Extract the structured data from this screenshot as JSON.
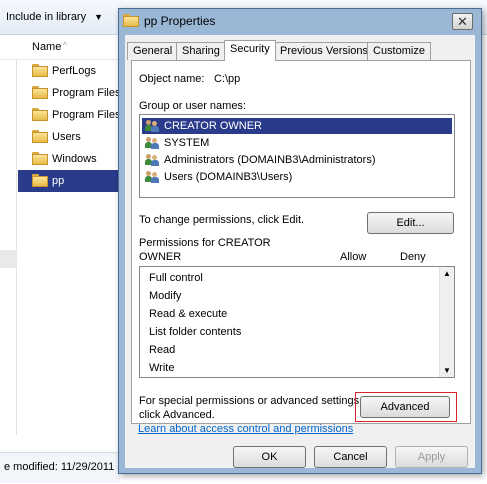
{
  "explorer": {
    "toolbar": {
      "include_label": "Include in library",
      "arrow": "▼"
    },
    "column_name": "Name",
    "sort_glyph": "^",
    "files": [
      {
        "name": "PerfLogs",
        "selected": false
      },
      {
        "name": "Program Files",
        "selected": false
      },
      {
        "name": "Program Files",
        "selected": false
      },
      {
        "name": "Users",
        "selected": false
      },
      {
        "name": "Windows",
        "selected": false
      },
      {
        "name": "pp",
        "selected": true
      }
    ],
    "status": "e modified:  11/29/2011"
  },
  "dialog": {
    "title": "pp Properties",
    "close_glyph": "✕",
    "tabs": [
      "General",
      "Sharing",
      "Security",
      "Previous Versions",
      "Customize"
    ],
    "active_tab": "Security",
    "object_name_label": "Object name:",
    "object_name_value": "C:\\pp",
    "group_label": "Group or user names:",
    "users": [
      {
        "name": "CREATOR OWNER",
        "selected": true
      },
      {
        "name": "SYSTEM",
        "selected": false
      },
      {
        "name": "Administrators (DOMAINB3\\Administrators)",
        "selected": false
      },
      {
        "name": "Users (DOMAINB3\\Users)",
        "selected": false
      }
    ],
    "change_text": "To change permissions, click Edit.",
    "edit_button": "Edit...",
    "permissions_for_line1": "Permissions for CREATOR",
    "permissions_for_line2": "OWNER",
    "allow_label": "Allow",
    "deny_label": "Deny",
    "permissions": [
      "Full control",
      "Modify",
      "Read & execute",
      "List folder contents",
      "Read",
      "Write"
    ],
    "scroll_up_glyph": "▲",
    "scroll_down_glyph": "▼",
    "special_line1": "For special permissions or advanced settings,",
    "special_line2": "click Advanced.",
    "advanced_button": "Advanced",
    "learn_link": "Learn about access control and permissions",
    "ok_button": "OK",
    "cancel_button": "Cancel",
    "apply_button": "Apply"
  },
  "colors": {
    "selection": "#2b3b8c",
    "highlight_box": "#d8232a",
    "link": "#0066cc"
  }
}
